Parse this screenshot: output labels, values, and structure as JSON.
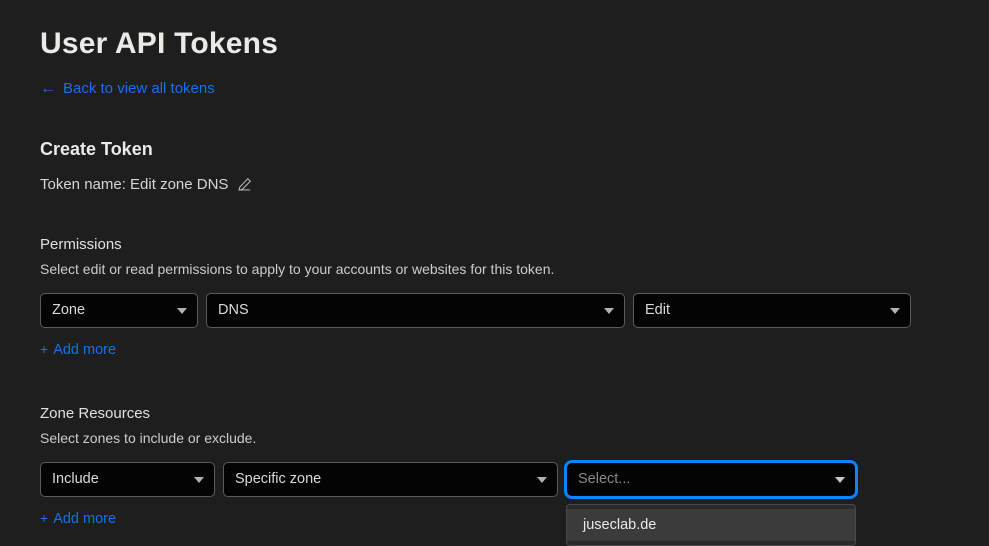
{
  "header": {
    "title": "User API Tokens",
    "back_link": {
      "icon": "arrow-left-icon",
      "label": "Back to view all tokens"
    }
  },
  "create_token": {
    "heading": "Create Token",
    "token_name_label": "Token name: Edit zone DNS",
    "edit_icon": "pencil-icon"
  },
  "permissions": {
    "heading": "Permissions",
    "description": "Select edit or read permissions to apply to your accounts or websites for this token.",
    "fields": [
      {
        "name": "permission-scope-select",
        "value": "Zone"
      },
      {
        "name": "permission-resource-select",
        "value": "DNS"
      },
      {
        "name": "permission-level-select",
        "value": "Edit"
      }
    ],
    "add_more": {
      "plus": "+",
      "label": "Add more"
    }
  },
  "zone_resources": {
    "heading": "Zone Resources",
    "description": "Select zones to include or exclude.",
    "fields": [
      {
        "name": "zone-inclusion-select",
        "value": "Include"
      },
      {
        "name": "zone-scope-select",
        "value": "Specific zone"
      }
    ],
    "zone_select": {
      "placeholder": "Select...",
      "focused": true,
      "options": [
        {
          "label": "juseclab.de"
        }
      ]
    },
    "add_more": {
      "plus": "+",
      "label": "Add more"
    }
  },
  "colors": {
    "page_background": "#1e1e1e",
    "field_background": "#040404",
    "link_blue": "#1a6fec",
    "focus_blue": "#0a84ff",
    "dropdown_option_background": "#3b3b3b"
  }
}
